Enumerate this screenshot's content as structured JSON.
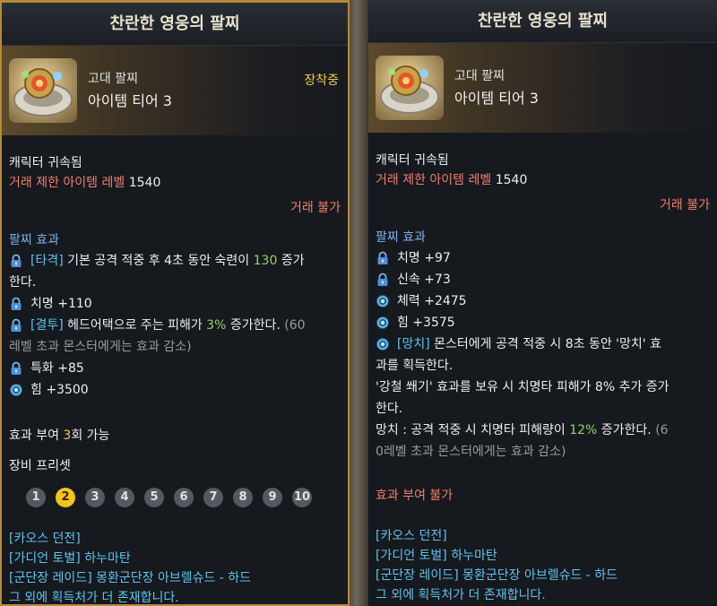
{
  "left": {
    "title": "찬란한 영웅의 팔찌",
    "grade": "고대 팔찌",
    "tier": "아이템 티어 3",
    "equipped": "장착중",
    "bound": "캐릭터 귀속됨",
    "trade_restrict_label": "거래 제한 아이템 레벨",
    "trade_restrict_value": "1540",
    "trade_status": "거래 불가",
    "effects_header": "팔찌 효과",
    "effects": {
      "e1_tag": "[타격]",
      "e1_text_a": " 기본 공격 적중 후 4초 동안 숙련이 ",
      "e1_num": "130",
      "e1_text_b": " 증가",
      "e1_line2": "한다.",
      "e2": "치명 +110",
      "e3_tag": "[결투]",
      "e3_text_a": " 헤드어택으로 주는 피해가 ",
      "e3_num": "3%",
      "e3_text_b": " 증가한다. ",
      "e3_gray_a": "(60",
      "e3_line2": "레벨 초과 몬스터에게는 효과 감소)",
      "e4": "특화 +85",
      "e5": "힘 +3500"
    },
    "grant_label": "효과 부여 ",
    "grant_num": "3",
    "grant_suffix": "회 가능",
    "preset_label": "장비 프리셋",
    "presets": [
      "1",
      "2",
      "3",
      "4",
      "5",
      "6",
      "7",
      "8",
      "9",
      "10"
    ],
    "active_preset": "2",
    "sources": {
      "s1": "[카오스 던전]",
      "s2": "[가디언 토벌] 하누마탄",
      "s3": "[군단장 레이드] 몽환군단장 아브렐슈드 - 하드",
      "s4": "그 외에 획득처가 더 존재합니다."
    }
  },
  "right": {
    "title": "찬란한 영웅의 팔찌",
    "grade": "고대 팔찌",
    "tier": "아이템 티어 3",
    "bound": "캐릭터 귀속됨",
    "trade_restrict_label": "거래 제한 아이템 레벨",
    "trade_restrict_value": "1540",
    "trade_status": "거래 불가",
    "effects_header": "팔찌 효과",
    "effects": {
      "e1": "치명 +97",
      "e2": "신속 +73",
      "e3": "체력 +2475",
      "e4": "힘 +3575",
      "e5_tag": "[망치]",
      "e5_text": " 몬스터에게 공격 적중 시 8초 동안 '망치' 효",
      "e5_line2": "과를 획득한다.",
      "e5_line3": "'강철 쐐기' 효과를 보유 시 치명타 피해가 8% 추가 증가",
      "e5_line4": "한다.",
      "e5_line5_a": "망치 : 공격 적중 시 치명타 피해량이 ",
      "e5_line5_num": "12%",
      "e5_line5_b": " 증가한다. ",
      "e5_line5_gray": "(6",
      "e5_line6": "0레벨 초과 몬스터에게는 효과 감소)"
    },
    "grant_unavailable": "효과 부여 불가",
    "sources": {
      "s1": "[카오스 던전]",
      "s2": "[가디언 토벌] 하누마탄",
      "s3": "[군단장 레이드] 몽환군단장 아브렐슈드 - 하드",
      "s4": "그 외에 획득처가 더 존재합니다."
    }
  },
  "colors": {
    "frame": "#b48a3a",
    "red": "#f07f6e",
    "blue": "#7fb0f0",
    "green": "#8ed46a",
    "gold": "#f2c94c",
    "cyan": "#5fc4ee"
  },
  "icons": {
    "lock": "lock-icon",
    "stat": "stat-gem-icon",
    "item": "bracelet-item-icon"
  }
}
